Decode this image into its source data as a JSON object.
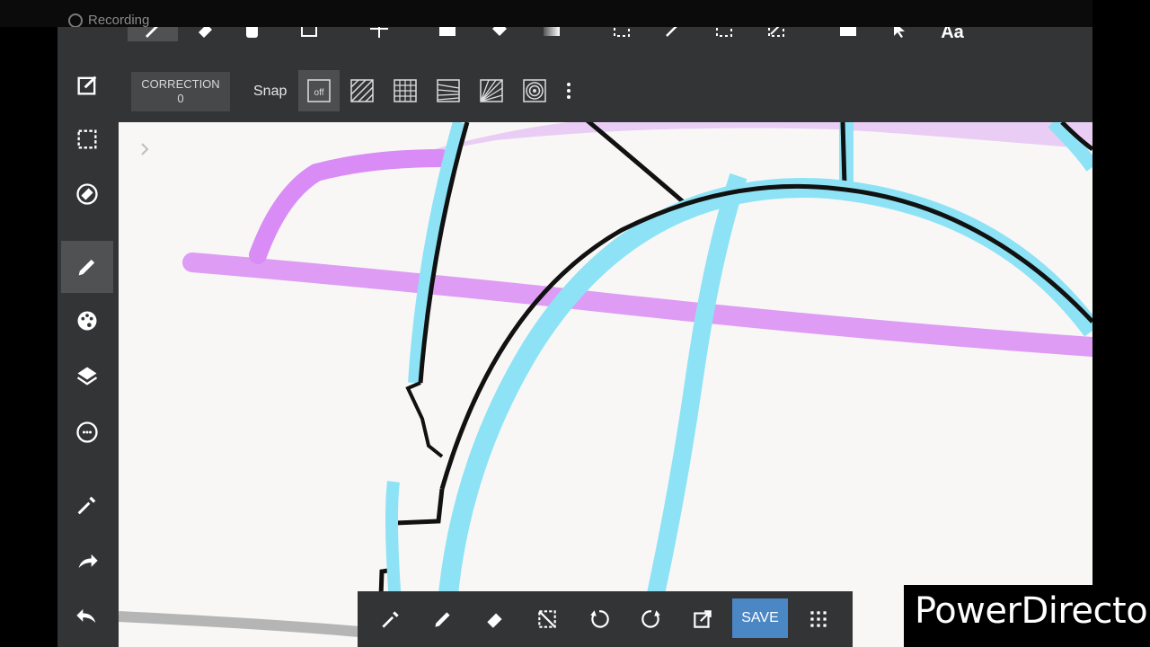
{
  "status_bar": {
    "recording_label": "Recording"
  },
  "top_toolbar": {
    "icons": [
      "brush-icon",
      "eraser-icon",
      "hand-icon",
      "rectangle-select-icon",
      "move-icon",
      "fill-rect-icon",
      "bucket-icon",
      "gradient-icon",
      "marquee-icon",
      "lasso-wand-icon",
      "transform-icon",
      "deselect-icon",
      "panel-icon",
      "cursor-icon"
    ],
    "text_tool_label": "Aa"
  },
  "sub_toolbar": {
    "correction_label": "CORRECTION",
    "correction_value": "0",
    "snap_label": "Snap",
    "snap_off_label": "off"
  },
  "sidebar": {
    "items": [
      "edit-icon",
      "selection-icon",
      "rotate-icon",
      "pen-icon",
      "palette-icon",
      "layers-icon",
      "materials-icon",
      "eyedropper-icon",
      "redo-icon",
      "undo-icon"
    ]
  },
  "bottom_bar": {
    "items": [
      "eyedropper-icon",
      "pen-icon",
      "eraser-icon",
      "deselect-icon",
      "undo-icon",
      "redo-icon",
      "export-icon"
    ],
    "save_label": "SAVE"
  },
  "watermark": {
    "text": "PowerDirector"
  },
  "colors": {
    "panel": "#333436",
    "canvas": "#f8f7f6",
    "save_button": "#4a87c4",
    "stroke_purple": "#d98cf5",
    "stroke_cyan": "#8de3f5",
    "stroke_black": "#111111"
  }
}
